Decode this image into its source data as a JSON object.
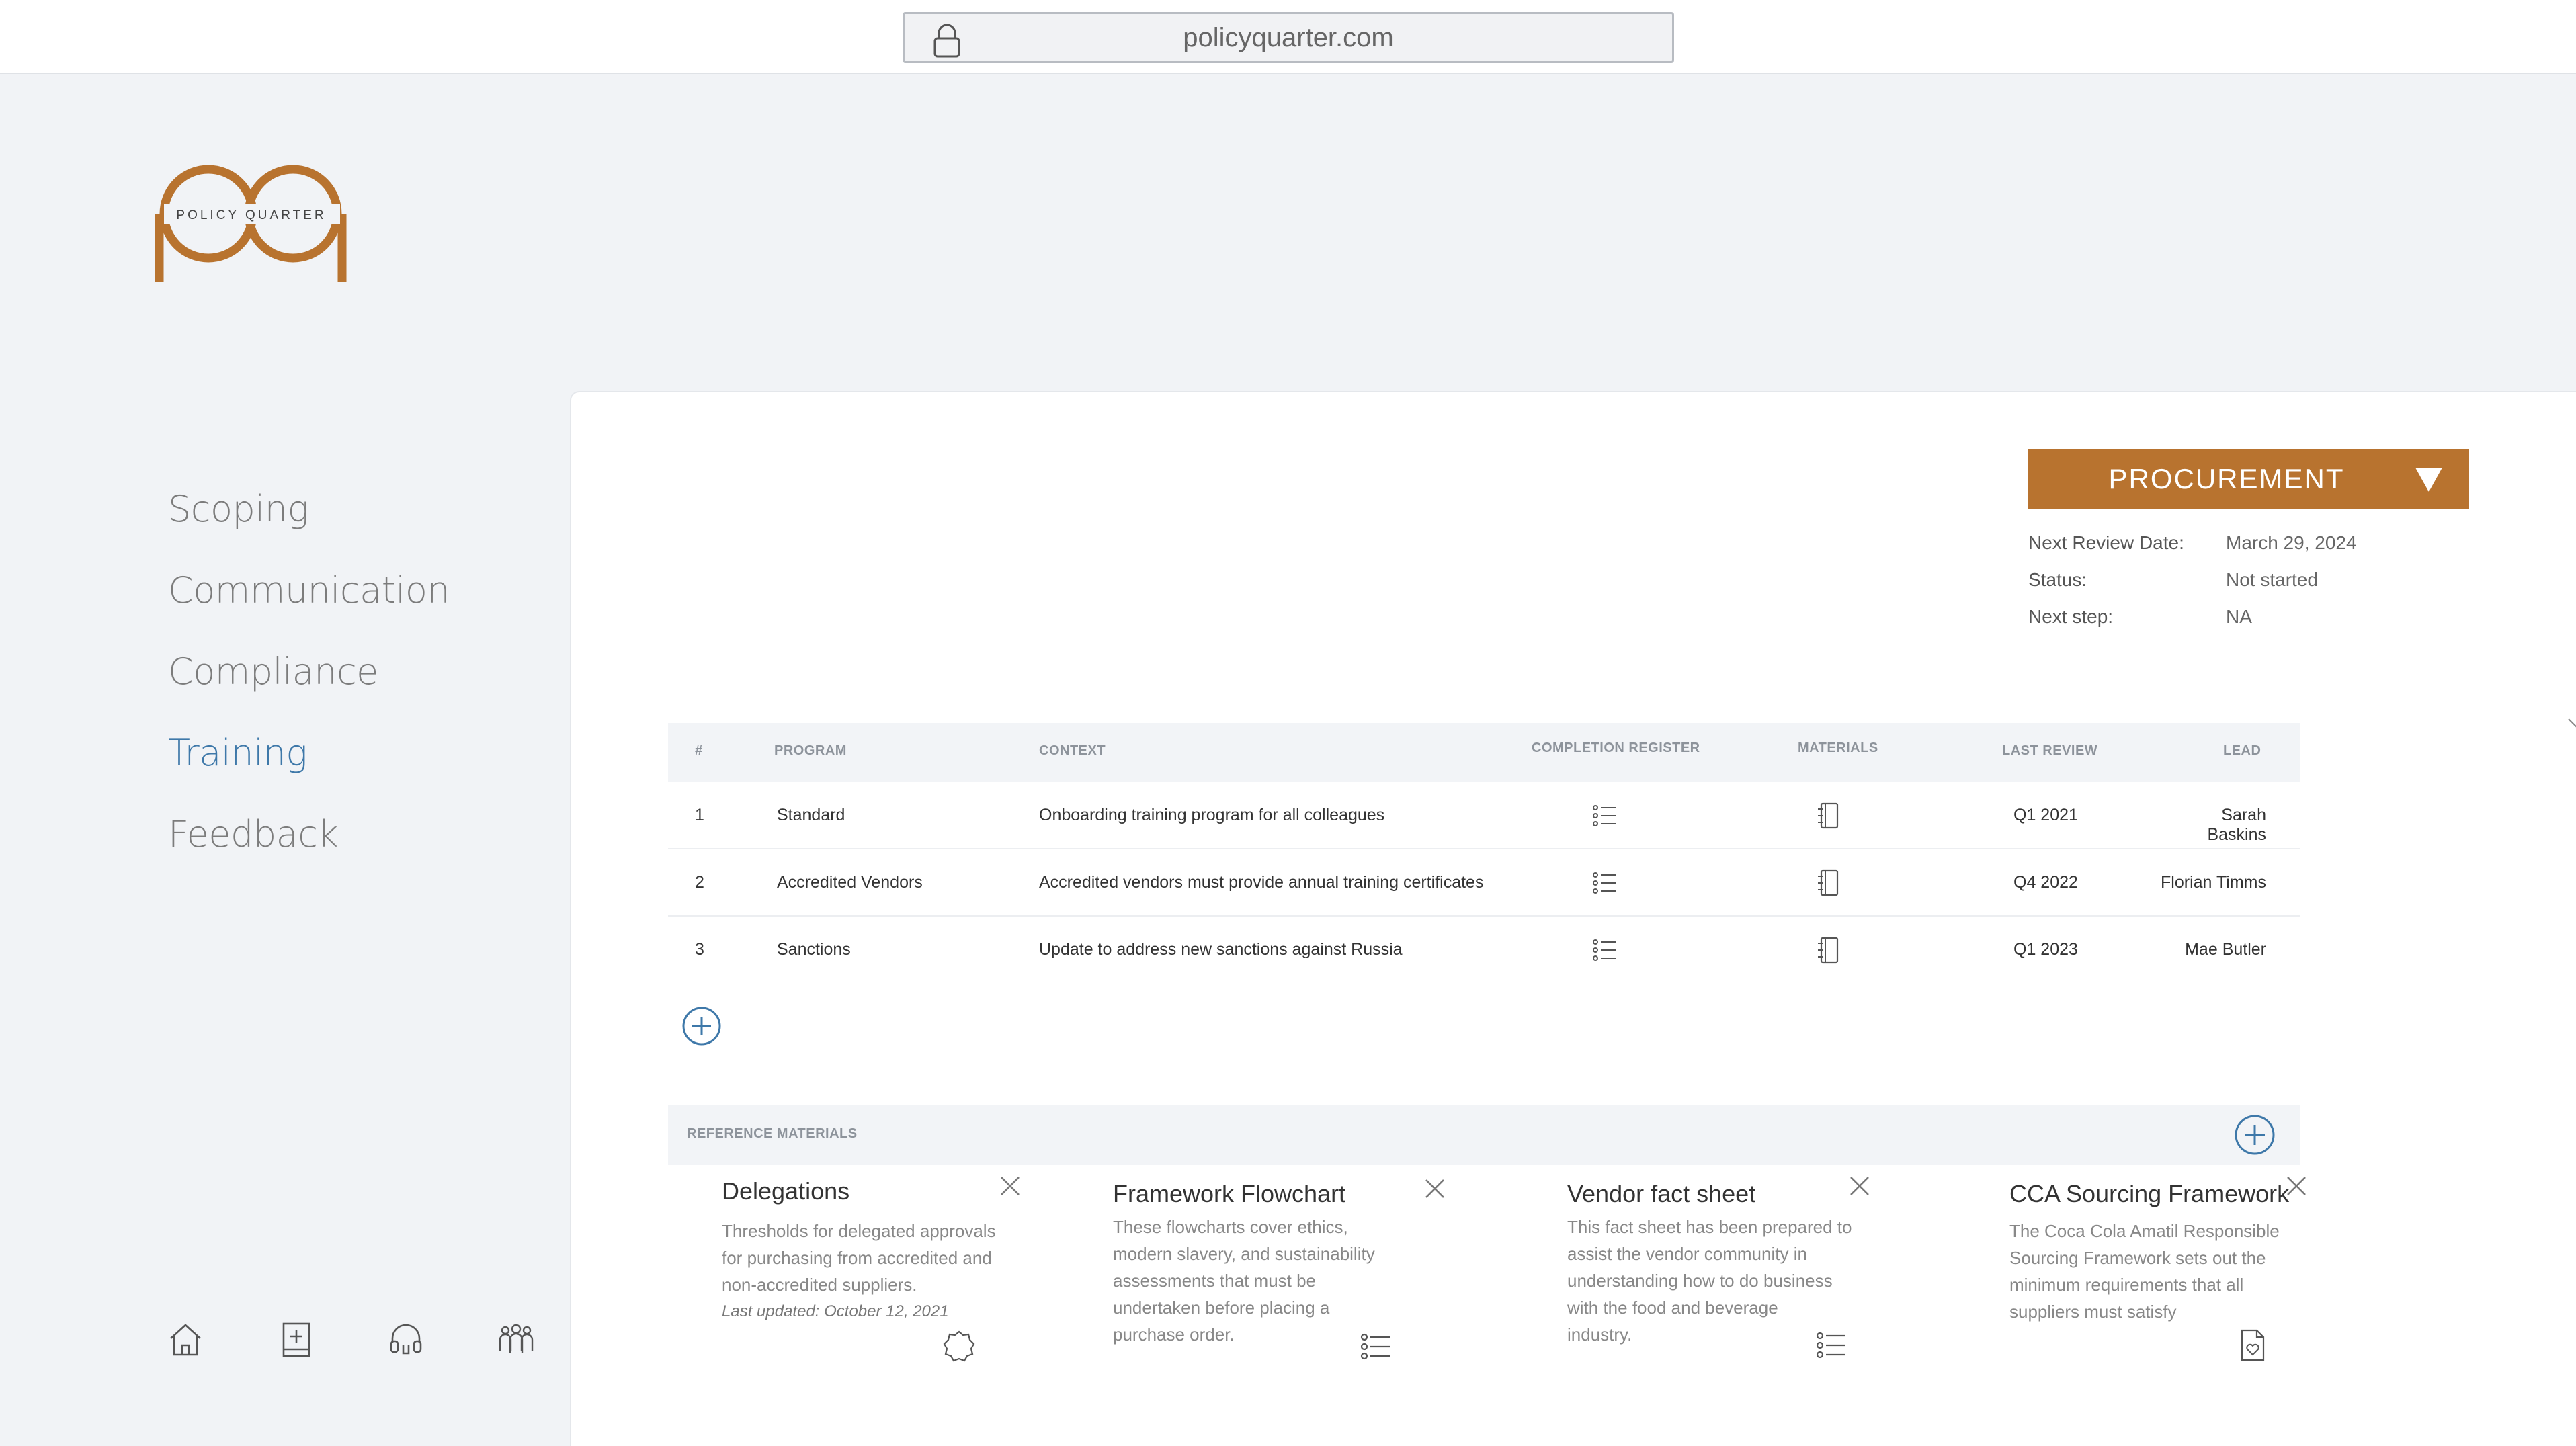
{
  "browser": {
    "url": "policyquarter.com"
  },
  "logo": {
    "text": "POLICY QUARTER",
    "brand_color": "#b8732f"
  },
  "sidebar": {
    "items": [
      {
        "label": "Scoping",
        "active": false
      },
      {
        "label": "Communication",
        "active": false
      },
      {
        "label": "Compliance",
        "active": false
      },
      {
        "label": "Training",
        "active": true
      },
      {
        "label": "Feedback",
        "active": false
      }
    ],
    "bottom_icons": [
      "home-icon",
      "notebook-add-icon",
      "headset-icon",
      "team-icon"
    ]
  },
  "header": {
    "dropdown": {
      "label": "PROCUREMENT"
    },
    "meta": [
      {
        "key": "Next Review Date:",
        "value": "March 29, 2024"
      },
      {
        "key": "Status:",
        "value": "Not started"
      },
      {
        "key": "Next step:",
        "value": "NA"
      }
    ]
  },
  "table": {
    "columns": {
      "num": "#",
      "program": "PROGRAM",
      "context": "CONTEXT",
      "completion": "COMPLETION REGISTER",
      "materials": "MATERIALS",
      "last_review": "LAST REVIEW",
      "lead": "LEAD"
    },
    "rows": [
      {
        "num": "1",
        "program": "Standard",
        "context": "Onboarding training program for all colleagues",
        "last_review": "Q1 2021",
        "lead": "Sarah Baskins"
      },
      {
        "num": "2",
        "program": "Accredited Vendors",
        "context": "Accredited vendors must provide annual training certificates",
        "last_review": "Q4 2022",
        "lead": "Florian Timms"
      },
      {
        "num": "3",
        "program": "Sanctions",
        "context": "Update to address new sanctions against Russia",
        "last_review": "Q1 2023",
        "lead": "Mae Butler"
      }
    ]
  },
  "reference": {
    "label": "REFERENCE MATERIALS",
    "cards": [
      {
        "title": "Delegations",
        "lines": [
          "Thresholds for delegated approvals",
          "for purchasing from accredited and",
          "non-accredited suppliers."
        ],
        "updated": "Last updated:  October  12, 2021",
        "icon": "badge-icon"
      },
      {
        "title": "Framework Flowchart",
        "lines": [
          "These flowcharts cover ethics,",
          "modern slavery, and sustainability",
          "assessments that must be",
          "undertaken before placing a",
          "purchase order."
        ],
        "updated": "",
        "icon": "list-icon"
      },
      {
        "title": "Vendor fact sheet",
        "lines": [
          "This fact sheet has been prepared to",
          "assist the vendor community in",
          "understanding how to do business",
          "with the food and beverage",
          "industry."
        ],
        "updated": "",
        "icon": "list-icon"
      },
      {
        "title": "CCA Sourcing Framework",
        "lines": [
          "The Coca Cola Amatil Responsible",
          "Sourcing Framework sets out the",
          "minimum requirements that all",
          "suppliers must satisfy"
        ],
        "updated": "",
        "icon": "document-heart-icon"
      }
    ]
  }
}
